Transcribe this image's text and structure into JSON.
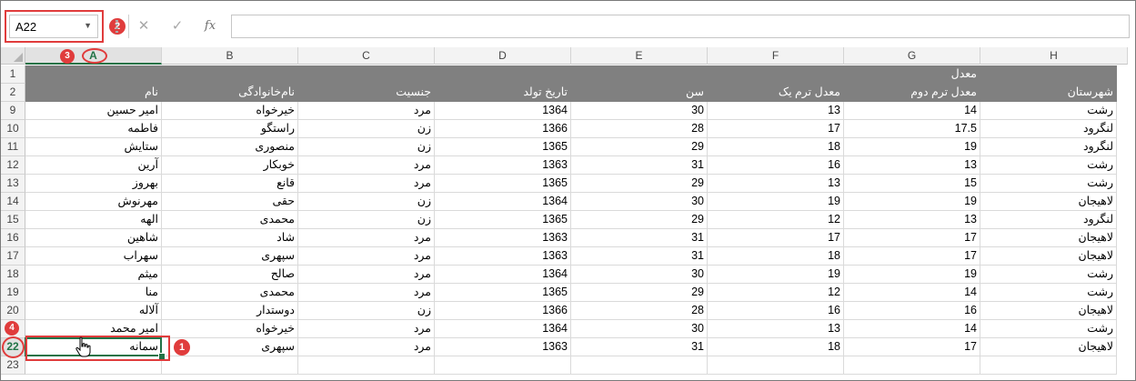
{
  "name_box": {
    "value": "A22"
  },
  "formula_bar": {
    "cancel_glyph": "✕",
    "enter_glyph": "✓",
    "function_label": "fx",
    "content": ""
  },
  "annotations": [
    "1",
    "2",
    "3",
    "4"
  ],
  "accent_color": "#217346",
  "annotation_color": "#e03c3c",
  "header_fill": "#808080",
  "columns": [
    "A",
    "B",
    "C",
    "D",
    "E",
    "F",
    "G",
    "H"
  ],
  "selected_column": "A",
  "selected_row": "22",
  "header_row1": {
    "G": "معدل"
  },
  "header_row2": [
    "نام",
    "نام‌خانوادگی",
    "جنسیت",
    "تاریخ تولد",
    "سن",
    "معدل ترم یک",
    "معدل ترم دوم",
    "شهرستان"
  ],
  "rows": [
    {
      "num": "9",
      "cells": [
        "امیر حسین",
        "خیرخواه",
        "مرد",
        "1364",
        "30",
        "13",
        "14",
        "رشت"
      ]
    },
    {
      "num": "10",
      "cells": [
        "فاطمه",
        "راستگو",
        "زن",
        "1366",
        "28",
        "17",
        "17.5",
        "لنگرود"
      ]
    },
    {
      "num": "11",
      "cells": [
        "ستایش",
        "منصوری",
        "زن",
        "1365",
        "29",
        "18",
        "19",
        "لنگرود"
      ]
    },
    {
      "num": "12",
      "cells": [
        "آرین",
        "خوبکار",
        "مرد",
        "1363",
        "31",
        "16",
        "13",
        "رشت"
      ]
    },
    {
      "num": "13",
      "cells": [
        "بهروز",
        "قانع",
        "مرد",
        "1365",
        "29",
        "13",
        "15",
        "رشت"
      ]
    },
    {
      "num": "14",
      "cells": [
        "مهرنوش",
        "حقی",
        "زن",
        "1364",
        "30",
        "19",
        "19",
        "لاهیجان"
      ]
    },
    {
      "num": "15",
      "cells": [
        "الهه",
        "محمدی",
        "زن",
        "1365",
        "29",
        "12",
        "13",
        "لنگرود"
      ]
    },
    {
      "num": "16",
      "cells": [
        "شاهین",
        "شاد",
        "مرد",
        "1363",
        "31",
        "17",
        "17",
        "لاهیجان"
      ]
    },
    {
      "num": "17",
      "cells": [
        "سهراب",
        "سپهری",
        "مرد",
        "1363",
        "31",
        "18",
        "17",
        "لاهیجان"
      ]
    },
    {
      "num": "18",
      "cells": [
        "میثم",
        "صالح",
        "مرد",
        "1364",
        "30",
        "19",
        "19",
        "رشت"
      ]
    },
    {
      "num": "19",
      "cells": [
        "منا",
        "محمدی",
        "مرد",
        "1365",
        "29",
        "12",
        "14",
        "رشت"
      ]
    },
    {
      "num": "20",
      "cells": [
        "آلاله",
        "دوستدار",
        "زن",
        "1366",
        "28",
        "16",
        "16",
        "لاهیجان"
      ]
    },
    {
      "num": "21",
      "cells": [
        "امیر محمد",
        "خیرخواه",
        "مرد",
        "1364",
        "30",
        "13",
        "14",
        "رشت"
      ]
    },
    {
      "num": "22",
      "cells": [
        "سمانه",
        "سپهری",
        "مرد",
        "1363",
        "31",
        "18",
        "17",
        "لاهیجان"
      ]
    },
    {
      "num": "23",
      "cells": [
        "",
        "",
        "",
        "",
        "",
        "",
        "",
        ""
      ]
    }
  ],
  "header_row_numbers": [
    "1",
    "2"
  ]
}
